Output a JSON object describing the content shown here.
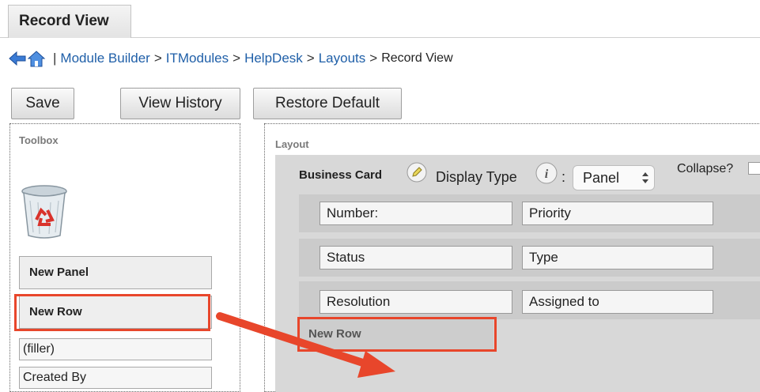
{
  "tab": {
    "label": "Record View"
  },
  "breadcrumb": {
    "separator": "|",
    "items": [
      "Module Builder",
      "ITModules",
      "HelpDesk",
      "Layouts"
    ],
    "arrow": ">",
    "current": "Record View"
  },
  "toolbar": {
    "save_label": "Save",
    "history_label": "View History",
    "restore_label": "Restore Default"
  },
  "toolbox": {
    "title": "Toolbox",
    "trash_icon": "recycle-bin-icon",
    "new_panel": "New Panel",
    "new_row": "New Row",
    "fields": [
      "(filler)",
      "Created By"
    ]
  },
  "layout": {
    "title": "Layout",
    "panel": {
      "name": "Business Card",
      "display_type_label": "Display Type",
      "colon": ":",
      "display_type_value": "Panel",
      "collapse_label": "Collapse?"
    },
    "rows": [
      {
        "left": "Number:",
        "right": "Priority"
      },
      {
        "left": "Status",
        "right": "Type"
      },
      {
        "left": "Resolution",
        "right": "Assigned to"
      }
    ],
    "dragged_row_label": "New Row"
  },
  "colors": {
    "highlight": "#e8462b",
    "link": "#1f5fa8"
  }
}
